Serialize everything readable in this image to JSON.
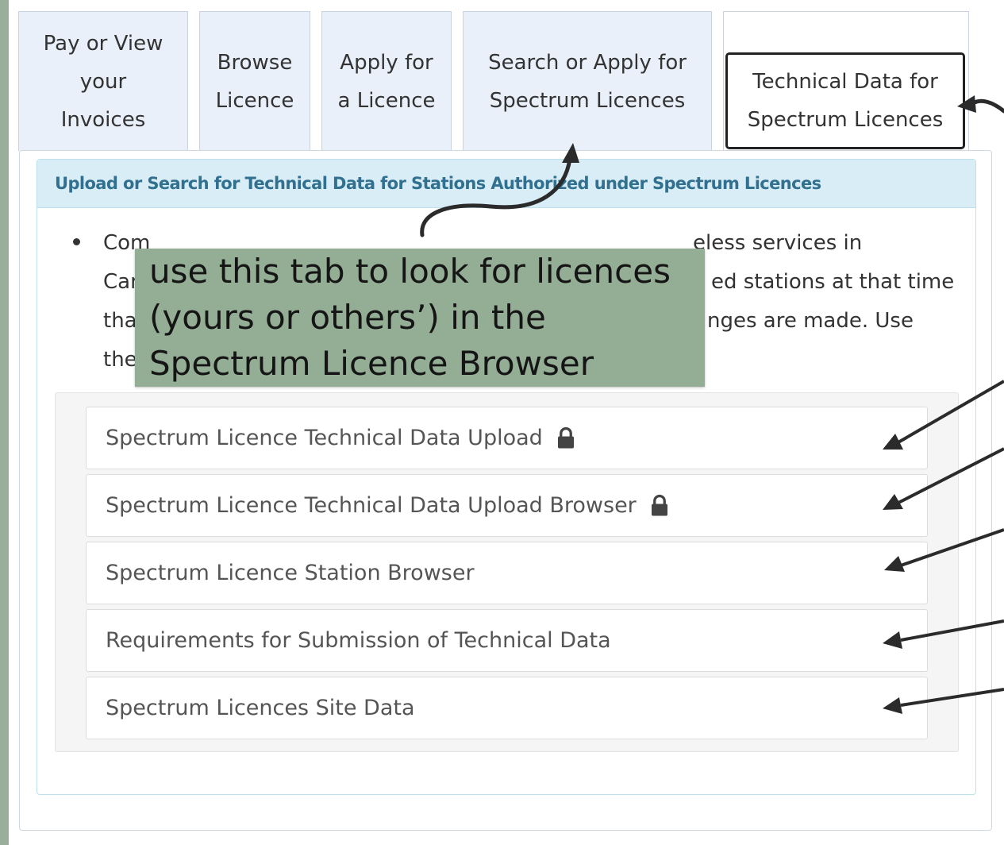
{
  "tabs": [
    {
      "label": "Pay or View\nyour\nInvoices"
    },
    {
      "label": "Browse\nLicence"
    },
    {
      "label": "Apply for\na Licence"
    },
    {
      "label": "Search or Apply for\nSpectrum Licences"
    },
    {
      "label": "Technical Data for\nSpectrum Licences",
      "active": true
    }
  ],
  "panel": {
    "heading": "Upload or Search for Technical Data for Stations Authorized under Spectrum Licences",
    "bullet_visible_fragments": "Com ... eless services in\nCan ... ed stations at that time\ntha ... nges are made. Use\nthe"
  },
  "links": [
    {
      "label": "Spectrum Licence Technical Data Upload",
      "locked": true
    },
    {
      "label": "Spectrum Licence Technical Data Upload Browser",
      "locked": true
    },
    {
      "label": "Spectrum Licence Station Browser",
      "locked": false
    },
    {
      "label": "Requirements for Submission of Technical Data",
      "locked": false
    },
    {
      "label": "Spectrum Licences Site Data",
      "locked": false
    }
  ],
  "callout": {
    "text": "use this tab to look for licences\n(yours or others’) in the\nSpectrum Licence Browser"
  },
  "colors": {
    "background": "#9aae9b",
    "callout": "#94ad95",
    "tab_inactive": "#e9f0fa",
    "panel_heading": "#d9edf7",
    "heading_text": "#31708f"
  },
  "icons": [
    "lock-icon",
    "arrow-icon"
  ]
}
